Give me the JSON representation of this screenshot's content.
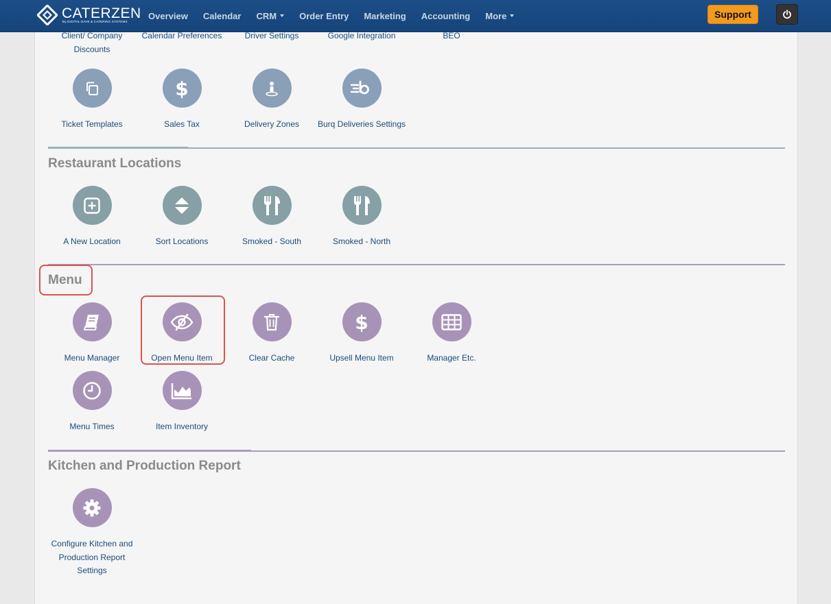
{
  "app": {
    "brand_name": "CATERZEN",
    "brand_sub": "By DIGITAL DAVE & CATERING SYSTEMS",
    "support_label": "Support"
  },
  "nav": {
    "items": [
      {
        "label": "Overview"
      },
      {
        "label": "Calendar"
      },
      {
        "label": "CRM",
        "dropdown": true
      },
      {
        "label": "Order Entry"
      },
      {
        "label": "Marketing"
      },
      {
        "label": "Accounting"
      },
      {
        "label": "More",
        "dropdown": true
      }
    ]
  },
  "top_section": {
    "row_cut": [
      "Client/ Company Discounts",
      "Calendar Preferences",
      "Driver Settings",
      "Google Integration",
      "BEO"
    ],
    "row2": [
      {
        "label": "Ticket Templates",
        "icon": "copy-icon"
      },
      {
        "label": "Sales Tax",
        "icon": "dollar-icon"
      },
      {
        "label": "Delivery Zones",
        "icon": "location-person-icon"
      },
      {
        "label": "Burq Deliveries Settings",
        "icon": "burq-icon"
      }
    ]
  },
  "restaurant_locations": {
    "title": "Restaurant Locations",
    "items": [
      {
        "label": "A New Location",
        "icon": "plus-square-icon"
      },
      {
        "label": "Sort Locations",
        "icon": "sort-icon"
      },
      {
        "label": "Smoked - South",
        "icon": "utensils-icon"
      },
      {
        "label": "Smoked - North",
        "icon": "utensils-icon"
      }
    ]
  },
  "menu": {
    "title": "Menu",
    "items": [
      {
        "label": "Menu Manager",
        "icon": "book-icon"
      },
      {
        "label": "Open Menu Item",
        "icon": "eye-slash-icon"
      },
      {
        "label": "Clear Cache",
        "icon": "trash-icon"
      },
      {
        "label": "Upsell Menu Item",
        "icon": "dollar-icon"
      },
      {
        "label": "Manager Etc.",
        "icon": "grid-icon"
      },
      {
        "label": "Menu Times",
        "icon": "clock-icon"
      },
      {
        "label": "Item Inventory",
        "icon": "area-chart-icon"
      }
    ]
  },
  "kitchen": {
    "title": "Kitchen and Production Report",
    "items": [
      {
        "label": "Configure Kitchen and Production Report Settings",
        "icon": "gear-icon"
      }
    ]
  },
  "colors": {
    "navbar": "#1a4a83",
    "support": "#f39a1e",
    "blue_icon": "#8a9fb8",
    "teal_icon": "#86a0a5",
    "purple_icon": "#a893b8",
    "highlight": "#d9534f",
    "link": "#1a4c7a"
  }
}
